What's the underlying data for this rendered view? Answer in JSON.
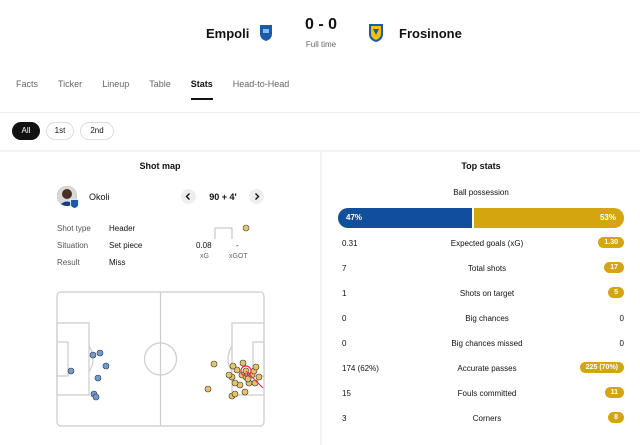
{
  "match": {
    "home": "Empoli",
    "away": "Frosinone",
    "score": "0 - 0",
    "status": "Full time",
    "home_color": "#114e9b",
    "away_color": "#d4a50f"
  },
  "tabs": [
    "Facts",
    "Ticker",
    "Lineup",
    "Table",
    "Stats",
    "Head-to-Head"
  ],
  "active_tab": "Stats",
  "filters": [
    "All",
    "1st",
    "2nd"
  ],
  "active_filter": "All",
  "shotmap": {
    "title": "Shot map",
    "player": "Okoli",
    "minute": "90 + 4'",
    "prev_icon": "chevron-left-icon",
    "next_icon": "chevron-right-icon",
    "labels": {
      "shot_type": "Shot type",
      "situation": "Situation",
      "result": "Result"
    },
    "values": {
      "shot_type": "Header",
      "situation": "Set piece",
      "result": "Miss"
    },
    "xg": "0.08",
    "xg_label": "xG",
    "xgot": "-",
    "xgot_label": "xGOT"
  },
  "top_stats": {
    "title": "Top stats",
    "possession_label": "Ball possession",
    "possession_home": "47%",
    "possession_away": "53%",
    "rows": [
      {
        "home": "0.31",
        "label": "Expected goals (xG)",
        "away": "1.30",
        "highlight": "away"
      },
      {
        "home": "7",
        "label": "Total shots",
        "away": "17",
        "highlight": "away"
      },
      {
        "home": "1",
        "label": "Shots on target",
        "away": "5",
        "highlight": "away"
      },
      {
        "home": "0",
        "label": "Big chances",
        "away": "0",
        "highlight": ""
      },
      {
        "home": "0",
        "label": "Big chances missed",
        "away": "0",
        "highlight": ""
      },
      {
        "home": "174 (62%)",
        "label": "Accurate passes",
        "away": "225 (70%)",
        "highlight": "away"
      },
      {
        "home": "15",
        "label": "Fouls committed",
        "away": "11",
        "highlight": "away"
      },
      {
        "home": "3",
        "label": "Corners",
        "away": "8",
        "highlight": "away"
      }
    ]
  }
}
